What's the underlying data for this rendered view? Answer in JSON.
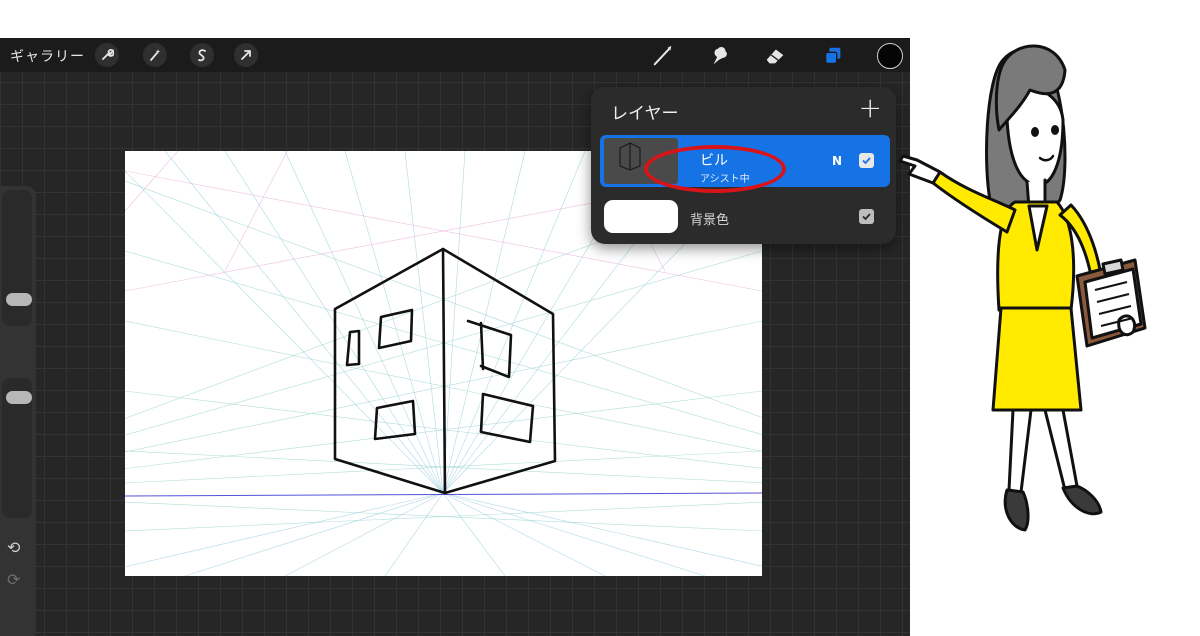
{
  "toolbar": {
    "gallery_label": "ギャラリー",
    "left_tools": [
      "wrench-icon",
      "magic-wand-icon",
      "selection-s-icon",
      "arrow-transform-icon"
    ],
    "right_tools": [
      "brush-icon",
      "smudge-icon",
      "eraser-icon",
      "layers-icon"
    ],
    "current_color": "#050505"
  },
  "layers": {
    "title": "レイヤー",
    "add_label": "+",
    "items": [
      {
        "name": "ビル",
        "sub": "アシスト中",
        "blend": "N",
        "selected": true,
        "visible": true
      },
      {
        "name": "背景色",
        "selected": false,
        "visible": true
      }
    ]
  },
  "colors": {
    "accent": "#1673e6",
    "annotation_ring": "#d81418",
    "app_bg": "#262626"
  }
}
